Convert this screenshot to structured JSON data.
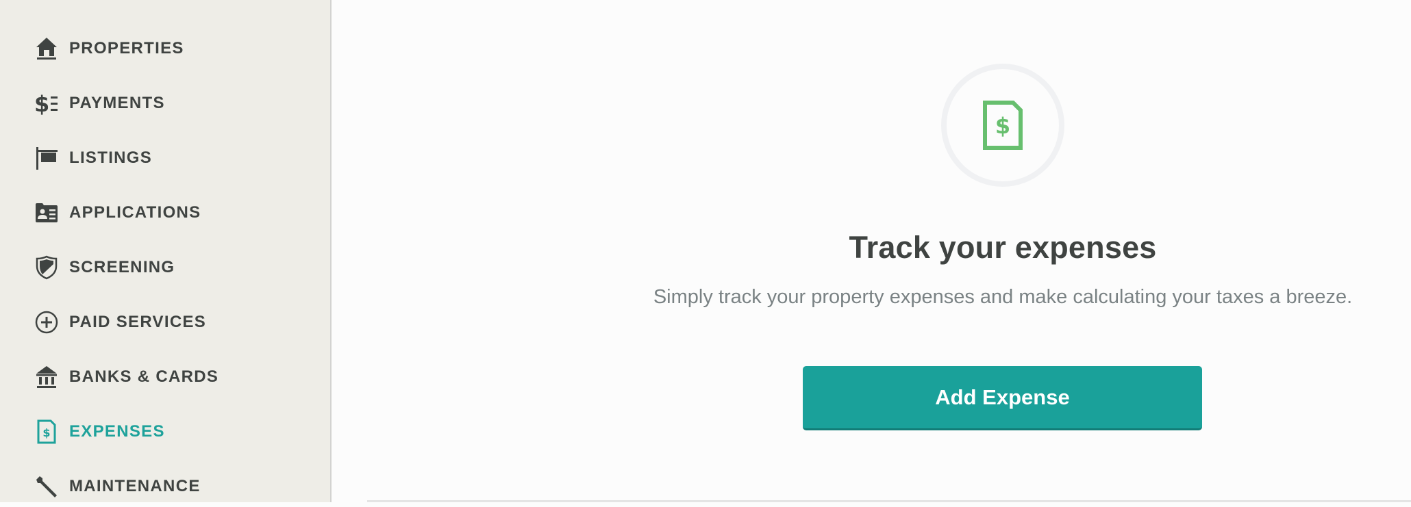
{
  "sidebar": {
    "active_color": "#1ea29b",
    "items": [
      {
        "label": "PROPERTIES",
        "icon": "home-icon",
        "active": false
      },
      {
        "label": "PAYMENTS",
        "icon": "dollar-list-icon",
        "active": false
      },
      {
        "label": "LISTINGS",
        "icon": "sign-post-icon",
        "active": false
      },
      {
        "label": "APPLICATIONS",
        "icon": "id-card-folder-icon",
        "active": false
      },
      {
        "label": "SCREENING",
        "icon": "shield-icon",
        "active": false
      },
      {
        "label": "PAID SERVICES",
        "icon": "plus-circle-icon",
        "active": false
      },
      {
        "label": "BANKS & CARDS",
        "icon": "bank-icon",
        "active": false
      },
      {
        "label": "EXPENSES",
        "icon": "expense-document-icon",
        "active": true
      },
      {
        "label": "MAINTENANCE",
        "icon": "wrench-icon",
        "active": false
      }
    ]
  },
  "empty_state": {
    "icon": "expense-document-icon",
    "icon_color": "#67bf6e",
    "title": "Track your expenses",
    "subtitle": "Simply track your property expenses and make calculating your taxes a breeze.",
    "button_label": "Add Expense",
    "button_color": "#1aa19a"
  }
}
